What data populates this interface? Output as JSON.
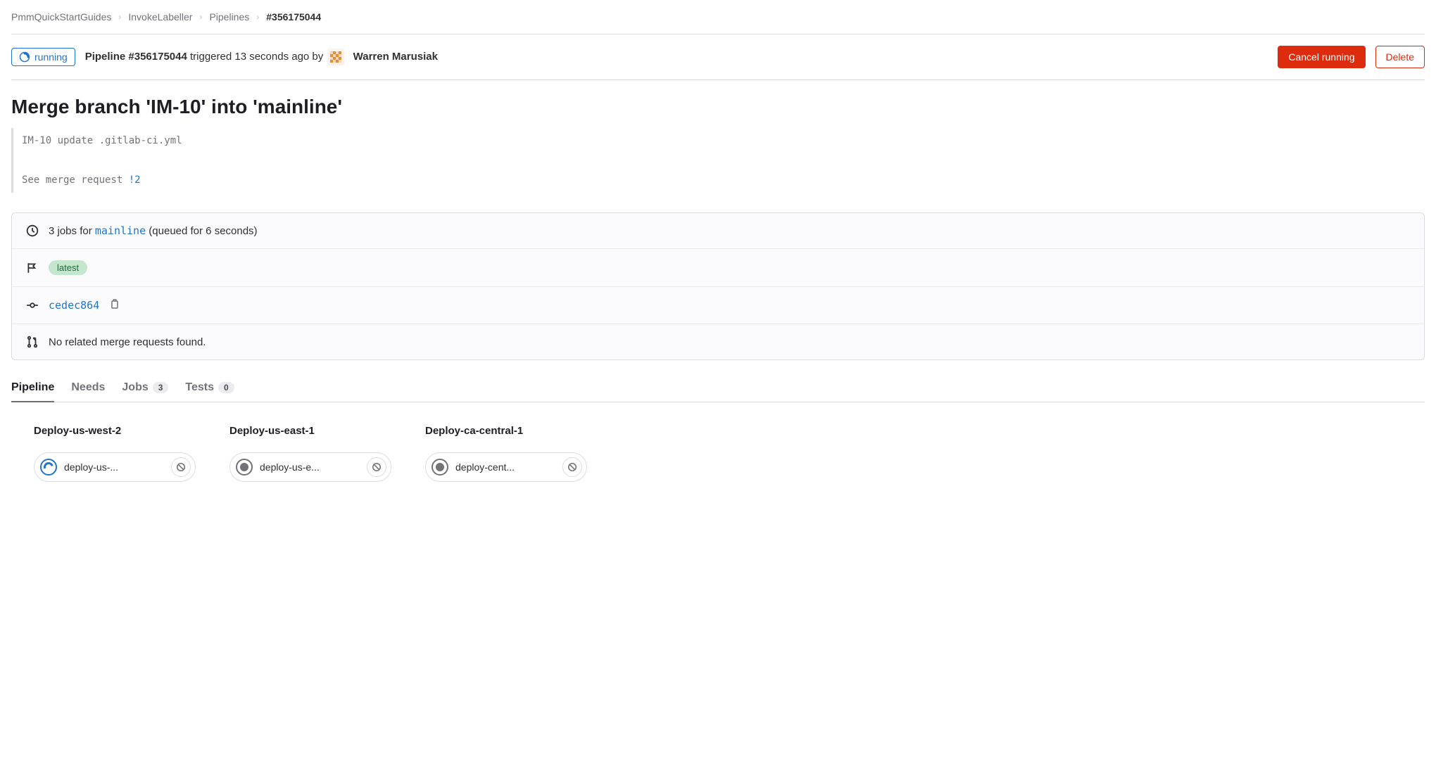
{
  "breadcrumb": {
    "items": [
      "PmmQuickStartGuides",
      "InvokeLabeller",
      "Pipelines"
    ],
    "current": "#356175044"
  },
  "header": {
    "status_label": "running",
    "pipeline_prefix": "Pipeline #356175044",
    "triggered_text": " triggered 13 seconds ago by ",
    "user": "Warren Marusiak",
    "cancel_label": "Cancel running",
    "delete_label": "Delete"
  },
  "title": "Merge branch 'IM-10' into 'mainline'",
  "commit_msg": {
    "line1": "IM-10 update .gitlab-ci.yml",
    "line2_prefix": "See merge request ",
    "mr_ref": "!2"
  },
  "info": {
    "jobs_prefix": "3 jobs for ",
    "branch": "mainline",
    "jobs_suffix": " (queued for 6 seconds)",
    "tag": "latest",
    "commit_sha": "cedec864",
    "mr_status": "No related merge requests found."
  },
  "tabs": [
    {
      "label": "Pipeline",
      "count": null,
      "active": true
    },
    {
      "label": "Needs",
      "count": null,
      "active": false
    },
    {
      "label": "Jobs",
      "count": "3",
      "active": false
    },
    {
      "label": "Tests",
      "count": "0",
      "active": false
    }
  ],
  "stages": [
    {
      "title": "Deploy-us-west-2",
      "job_name": "deploy-us-...",
      "status": "running"
    },
    {
      "title": "Deploy-us-east-1",
      "job_name": "deploy-us-e...",
      "status": "pending"
    },
    {
      "title": "Deploy-ca-central-1",
      "job_name": "deploy-cent...",
      "status": "pending"
    }
  ]
}
